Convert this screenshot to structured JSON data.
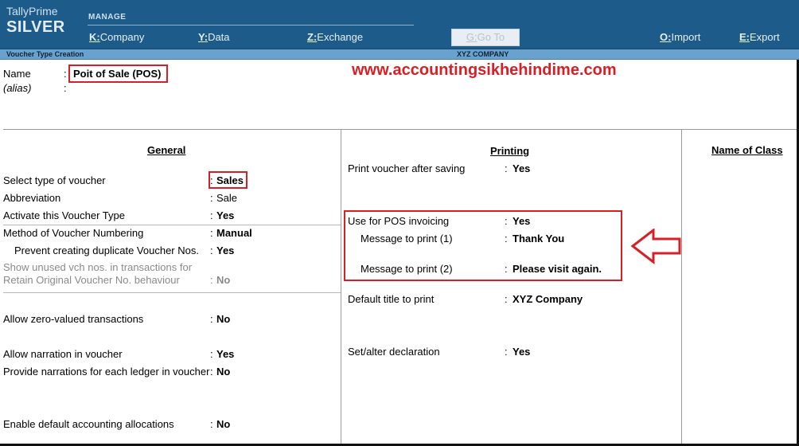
{
  "app": {
    "name": "TallyPrime",
    "edition": "SILVER"
  },
  "topbar": {
    "section_label": "MANAGE",
    "menu": [
      {
        "key": "K",
        "label": "Company"
      },
      {
        "key": "Y",
        "label": "Data"
      },
      {
        "key": "Z",
        "label": "Exchange"
      },
      {
        "key": "G",
        "label": "Go To"
      },
      {
        "key": "O",
        "label": "Import"
      },
      {
        "key": "E",
        "label": "Export"
      }
    ]
  },
  "title_strip": {
    "screen": "Voucher Type Creation",
    "company": "XYZ COMPANY"
  },
  "watermark": "www.accountingsikhehindime.com",
  "header": {
    "name_label": "Name",
    "name_value": "Poit of Sale (POS)",
    "alias_label": "(alias)",
    "alias_value": ""
  },
  "general": {
    "title": "General",
    "rows": [
      {
        "label": "Select type of voucher",
        "value": "Sales"
      },
      {
        "label": "Abbreviation",
        "value": "Sale"
      },
      {
        "label": "Activate this Voucher Type",
        "value": "Yes"
      },
      {
        "label": "Method of Voucher Numbering",
        "value": "Manual"
      },
      {
        "label": "Prevent creating duplicate Voucher Nos.",
        "value": "Yes"
      },
      {
        "label": "Show unused vch nos. in transactions for",
        "value": ""
      },
      {
        "label": "Retain Original Voucher No. behaviour",
        "value": "No"
      },
      {
        "label": "Allow zero-valued transactions",
        "value": "No"
      },
      {
        "label": "Allow narration in voucher",
        "value": "Yes"
      },
      {
        "label": "Provide narrations for each ledger in voucher",
        "value": "No"
      },
      {
        "label": "Enable default accounting allocations",
        "value": "No"
      }
    ]
  },
  "printing": {
    "title": "Printing",
    "rows": [
      {
        "label": "Print voucher after saving",
        "value": "Yes"
      },
      {
        "label": "Use for POS invoicing",
        "value": "Yes"
      },
      {
        "label": "Message to print (1)",
        "value": "Thank You"
      },
      {
        "label": "Message to print (2)",
        "value": "Please visit again."
      },
      {
        "label": "Default title to print",
        "value": "XYZ Company"
      },
      {
        "label": "Set/alter declaration",
        "value": "Yes"
      }
    ]
  },
  "name_of_class": {
    "title": "Name of Class"
  },
  "colors": {
    "topbar": "#1d5b8a",
    "title_strip": "#6aa2cf",
    "highlight": "#d91f26"
  }
}
